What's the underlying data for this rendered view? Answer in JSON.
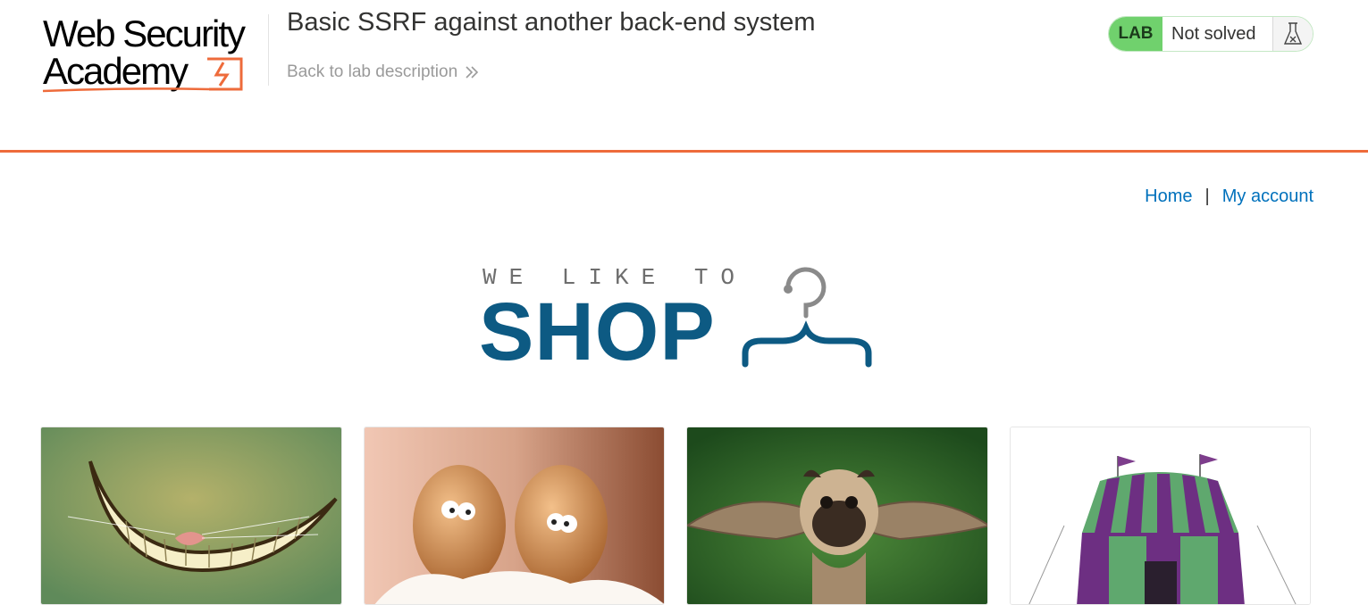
{
  "academy": {
    "logo_line1": "Web Security",
    "logo_line2": "Academy",
    "lab_title": "Basic SSRF against another back-end system",
    "back_link": "Back to lab description",
    "status": {
      "tag": "LAB",
      "text": "Not solved"
    }
  },
  "nav": {
    "home": "Home",
    "separator": "|",
    "my_account": "My account"
  },
  "banner": {
    "line1": "WE LIKE TO",
    "line2": "SHOP"
  },
  "colors": {
    "accent": "#ee6b3b",
    "link": "#0071bc",
    "shop_blue": "#0d5a83",
    "lab_green": "#70d16d"
  },
  "products": [
    {
      "image": "grinning-cat-smile"
    },
    {
      "image": "two-cartoon-eggs"
    },
    {
      "image": "flying-pug-with-wings"
    },
    {
      "image": "striped-circus-tent"
    }
  ]
}
